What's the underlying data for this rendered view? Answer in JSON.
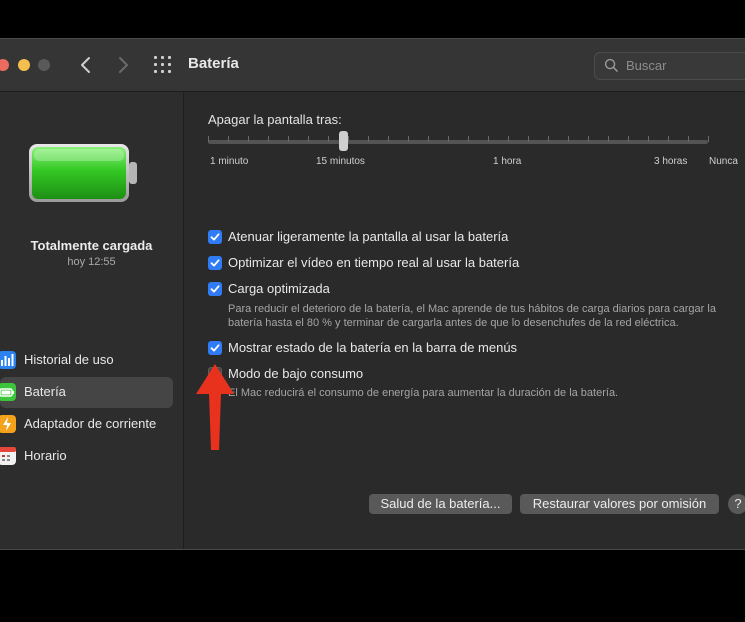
{
  "window": {
    "title": "Batería",
    "search_placeholder": "Buscar"
  },
  "sidebar": {
    "status_title": "Totalmente cargada",
    "status_time": "hoy 12:55",
    "items": [
      {
        "label": "Historial de uso",
        "icon": "usage-history-icon",
        "selected": false
      },
      {
        "label": "Batería",
        "icon": "battery-icon",
        "selected": true
      },
      {
        "label": "Adaptador de corriente",
        "icon": "power-adapter-icon",
        "selected": false
      },
      {
        "label": "Horario",
        "icon": "calendar-icon",
        "selected": false
      }
    ]
  },
  "main": {
    "slider_label": "Apagar la pantalla tras:",
    "slider_ticks": [
      "1 minuto",
      "15 minutos",
      "1 hora",
      "3 horas",
      "Nunca"
    ],
    "slider_value": "15 minutos",
    "options": [
      {
        "label": "Atenuar ligeramente la pantalla al usar la batería",
        "checked": true
      },
      {
        "label": "Optimizar el vídeo en tiempo real al usar la batería",
        "checked": true
      },
      {
        "label": "Carga optimizada",
        "checked": true,
        "description": "Para reducir el deterioro de la batería, el Mac aprende de tus hábitos de carga diarios para cargar la batería hasta el 80 % y terminar de cargarla antes de que lo desenchufes de la red eléctrica."
      },
      {
        "label": "Mostrar estado de la batería en la barra de menús",
        "checked": true
      },
      {
        "label": "Modo de bajo consumo",
        "checked": false,
        "description": "El Mac reducirá el consumo de energía para aumentar la duración de la batería."
      }
    ],
    "buttons": {
      "battery_health": "Salud de la batería...",
      "restore_defaults": "Restaurar valores por omisión",
      "help": "?"
    }
  },
  "colors": {
    "accent": "#2f7cf6",
    "annotation_arrow": "#e8321e",
    "battery_fill": "#2fc41f"
  }
}
